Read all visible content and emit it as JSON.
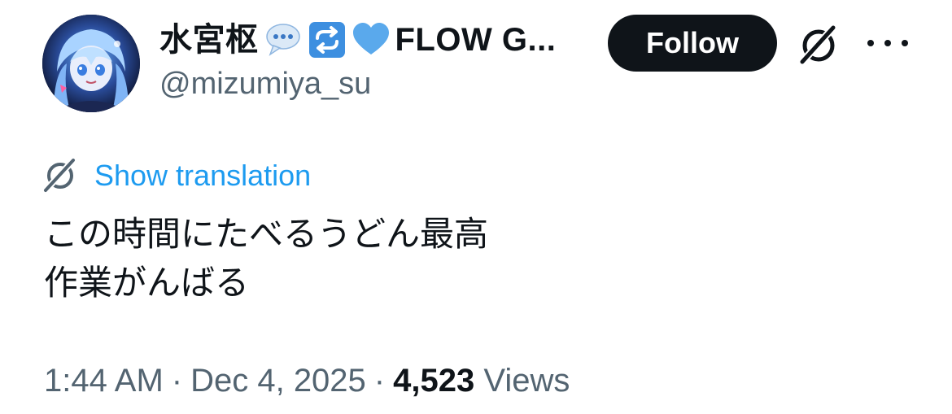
{
  "author": {
    "display_name": "水宮枢",
    "display_name_suffix": "FLOW G...",
    "handle": "@mizumiya_su",
    "emoji_icons": [
      "speech-bubble-icon",
      "repeat-button-icon",
      "blue-heart-icon"
    ]
  },
  "header": {
    "follow_label": "Follow"
  },
  "translation": {
    "label": "Show translation"
  },
  "tweet": {
    "lines": [
      "この時間にたべるうどん最高",
      "作業がんばる"
    ]
  },
  "meta": {
    "time": "1:44 AM",
    "separator": "·",
    "date": "Dec 4, 2025",
    "views_count": "4,523",
    "views_label": "Views"
  },
  "colors": {
    "accent": "#1d9bf0",
    "text": "#0f1419",
    "secondary": "#536471",
    "follow_bg": "#0f1419"
  }
}
